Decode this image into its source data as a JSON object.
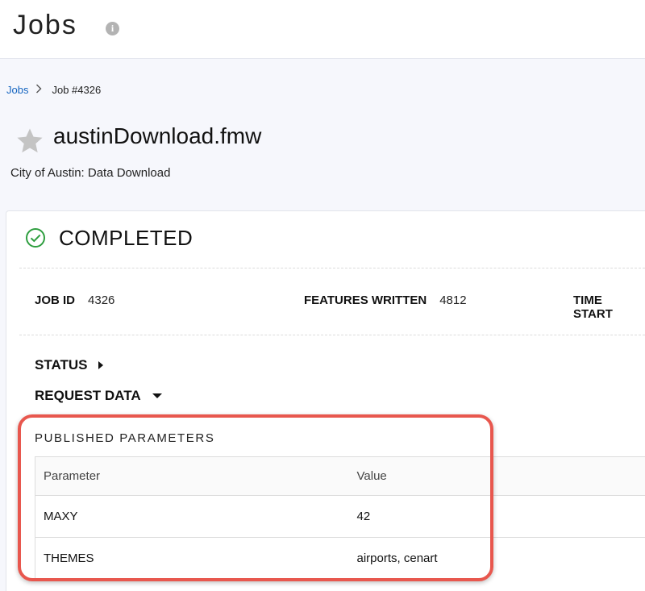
{
  "header": {
    "title": "Jobs",
    "info_icon": "info-icon"
  },
  "breadcrumb": {
    "parent": "Jobs",
    "separator": ">",
    "current": "Job #4326"
  },
  "job": {
    "name": "austinDownload.fmw",
    "description": "City of Austin: Data Download",
    "favorite_icon": "star-icon"
  },
  "status": {
    "label": "COMPLETED",
    "icon": "check-circle-icon",
    "color": "#2e9e3f"
  },
  "info": [
    {
      "key": "JOB ID",
      "value": "4326"
    },
    {
      "key": "FEATURES WRITTEN",
      "value": "4812"
    },
    {
      "key": "TIME START",
      "value": ""
    }
  ],
  "sections": {
    "status_label": "STATUS",
    "request_label": "REQUEST DATA"
  },
  "published_parameters": {
    "title": "PUBLISHED PARAMETERS",
    "columns": [
      "Parameter",
      "Value"
    ],
    "rows": [
      [
        "MAXY",
        "42"
      ],
      [
        "THEMES",
        "airports, cenart"
      ]
    ]
  },
  "colors": {
    "link": "#1565c0",
    "highlight": "#e8574e",
    "success": "#2e9e3f"
  }
}
